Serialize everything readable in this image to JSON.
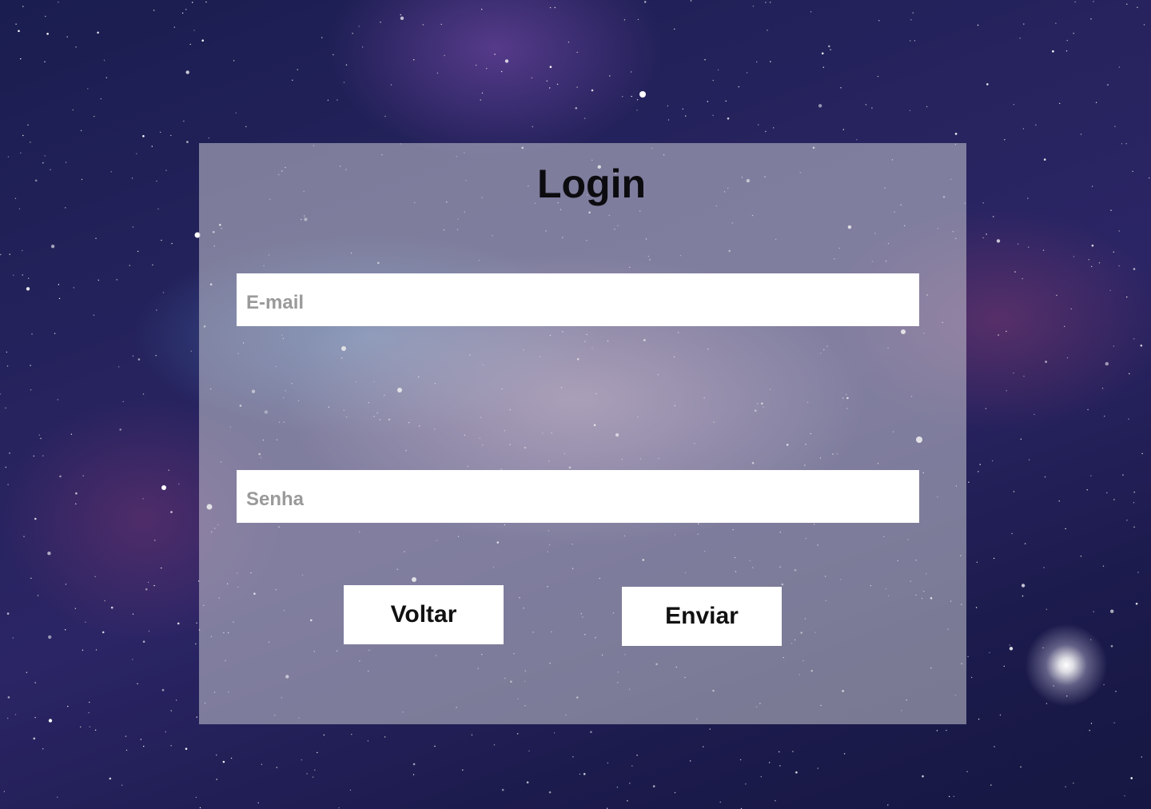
{
  "page": {
    "title": "Login"
  },
  "form": {
    "email_placeholder": "E-mail",
    "email_value": "",
    "password_placeholder": "Senha",
    "password_value": ""
  },
  "buttons": {
    "back_label": "Voltar",
    "submit_label": "Enviar"
  },
  "colors": {
    "panel_overlay": "#c8c8d2",
    "button_bg": "#ffffff",
    "title_text": "#0c0c10",
    "placeholder_text": "#9a9a9a"
  }
}
